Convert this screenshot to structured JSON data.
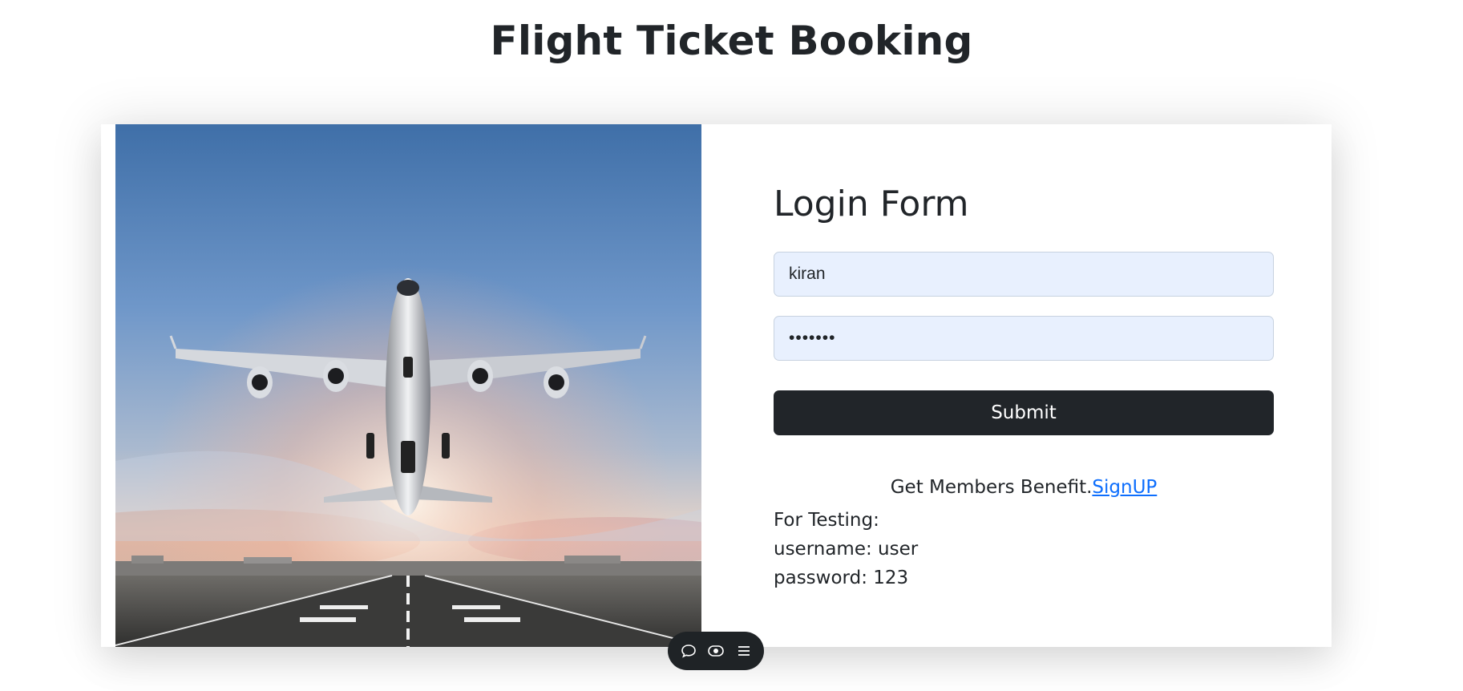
{
  "page": {
    "title": "Flight Ticket Booking"
  },
  "login": {
    "heading": "Login Form",
    "username_value": "kiran",
    "password_value": "•••••••",
    "submit_label": "Submit"
  },
  "signup": {
    "prompt": "Get Members Benefit.",
    "link_label": "SignUP"
  },
  "testing": {
    "header": "For Testing:",
    "username_line": "username: user",
    "password_line": "password: 123"
  },
  "toolbar": {
    "icons": [
      "chat-icon",
      "eye-icon",
      "menu-icon"
    ]
  },
  "colors": {
    "button_dark": "#212529",
    "link_blue": "#0d6efd",
    "input_fill": "#e8f0fe"
  }
}
